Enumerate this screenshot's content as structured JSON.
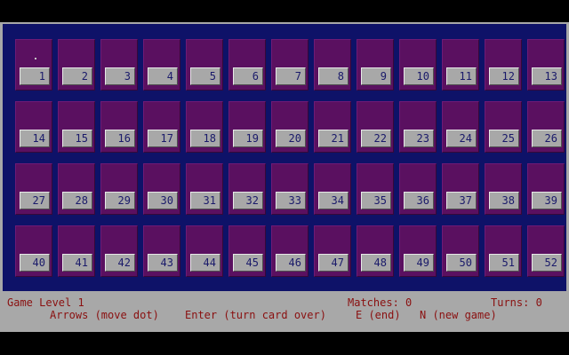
{
  "cards": [
    "1",
    "2",
    "3",
    "4",
    "5",
    "6",
    "7",
    "8",
    "9",
    "10",
    "11",
    "12",
    "13",
    "14",
    "15",
    "16",
    "17",
    "18",
    "19",
    "20",
    "21",
    "22",
    "23",
    "24",
    "25",
    "26",
    "27",
    "28",
    "29",
    "30",
    "31",
    "32",
    "33",
    "34",
    "35",
    "36",
    "37",
    "38",
    "39",
    "40",
    "41",
    "42",
    "43",
    "44",
    "45",
    "46",
    "47",
    "48",
    "49",
    "50",
    "51",
    "52"
  ],
  "cursor_card": "1",
  "status": {
    "level": "Game Level 1",
    "matches": "Matches: 0",
    "turns": "Turns: 0",
    "help_arrows": "Arrows (move dot)",
    "help_enter": "Enter (turn card over)",
    "help_end": "E (end)",
    "help_new": "N (new game)"
  },
  "colors": {
    "board_background": "#0e1268",
    "card_back": "#5a1060",
    "card_label_bg": "#a8a8a8",
    "status_bar_bg": "#a8a8a8",
    "status_text": "#8a1010"
  }
}
